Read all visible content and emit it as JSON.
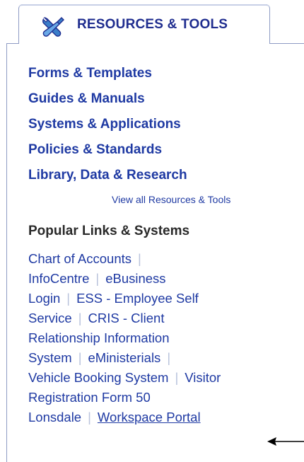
{
  "panel": {
    "tab_title": "RESOURCES & TOOLS",
    "tab_icon": "tools-icon"
  },
  "resources": {
    "links": [
      "Forms & Templates",
      "Guides & Manuals",
      "Systems & Applications",
      "Policies & Standards",
      "Library, Data & Research"
    ],
    "view_all": "View all Resources & Tools"
  },
  "popular": {
    "heading": "Popular Links & Systems",
    "chart_of_accounts": "Chart of Accounts",
    "infocentre": "InfoCentre",
    "ebusiness_login": "eBusiness Login",
    "ebusiness_part1": "eBusiness",
    "ebusiness_part2": "Login",
    "ess_part1": "ESS - Employee Self",
    "ess_part2": "Service",
    "cris_part1": "CRIS - Client",
    "cris_part2": "Relationship Information",
    "cris_part3": "System",
    "eministerials": "eMinisterials",
    "vehicle_booking": "Vehicle Booking System",
    "visitor_part1": "Visitor",
    "visitor_part2": "Registration Form 50",
    "lonsdale": "Lonsdale",
    "workspace_portal": "Workspace Portal",
    "separator": "|"
  },
  "annotation": {
    "arrow_icon": "arrow-left-icon"
  }
}
